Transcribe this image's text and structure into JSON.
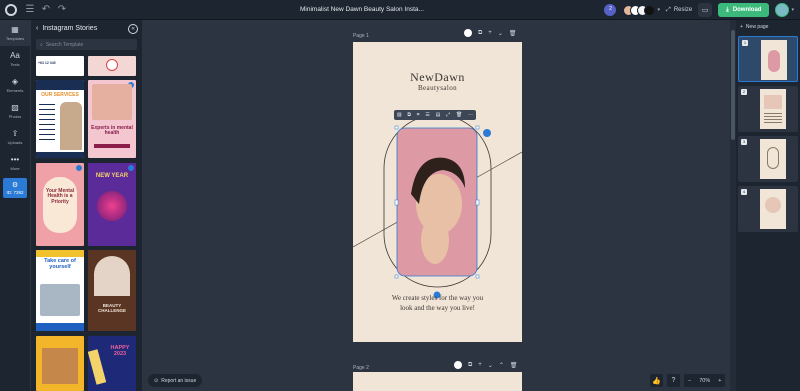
{
  "topbar": {
    "title": "Minimalist New Dawn Beauty Salon Insta...",
    "collab_count": "2",
    "resize_label": "Resize",
    "download_label": "Download",
    "swatches": [
      "#e3b89a",
      "#ffffff",
      "#f3f3f3",
      "#111111"
    ]
  },
  "rail": {
    "items": [
      {
        "label": "Templates",
        "icon": "template-icon"
      },
      {
        "label": "Texts",
        "icon": "text-icon"
      },
      {
        "label": "Elements",
        "icon": "elements-icon"
      },
      {
        "label": "Photos",
        "icon": "photo-icon"
      },
      {
        "label": "Uploads",
        "icon": "upload-icon"
      },
      {
        "label": "More",
        "icon": "more-icon"
      }
    ],
    "id_label": "ID: 7392"
  },
  "panel": {
    "title": "Instagram Stories",
    "search_placeholder": "Search Template",
    "templates": {
      "t1": {
        "label": "+63 12 345"
      },
      "t2": {
        "label": "OUR SERVICES"
      },
      "t3": {
        "label": "Experts in mental health"
      },
      "t4": {
        "label": "Your Mental Health is a Priority"
      },
      "t5": {
        "label": "NEW YEAR"
      },
      "t6": {
        "label": "Take care of yourself"
      },
      "t7": {
        "label": "BEAUTY CHALLENGE"
      },
      "t8": {
        "label": "HAPPY 2023"
      }
    }
  },
  "canvas": {
    "page1_label": "Page 1",
    "page2_label": "Page 2",
    "title": "NewDawn",
    "subtitle": "Beautysalon",
    "tagline_line1": "We create styles for the way you",
    "tagline_line2": "look and the way you live!"
  },
  "bottom": {
    "report_label": "Report an issue",
    "zoom": "70%",
    "minus": "−",
    "plus": "+"
  },
  "pages_panel": {
    "new_page_label": "New page",
    "thumbs": [
      "1",
      "2",
      "3",
      "4"
    ]
  },
  "colors": {
    "accent": "#2b7bd6",
    "download": "#3cba7b",
    "page_bg": "#f1e5d7",
    "photo_bg": "#de9aa4"
  }
}
